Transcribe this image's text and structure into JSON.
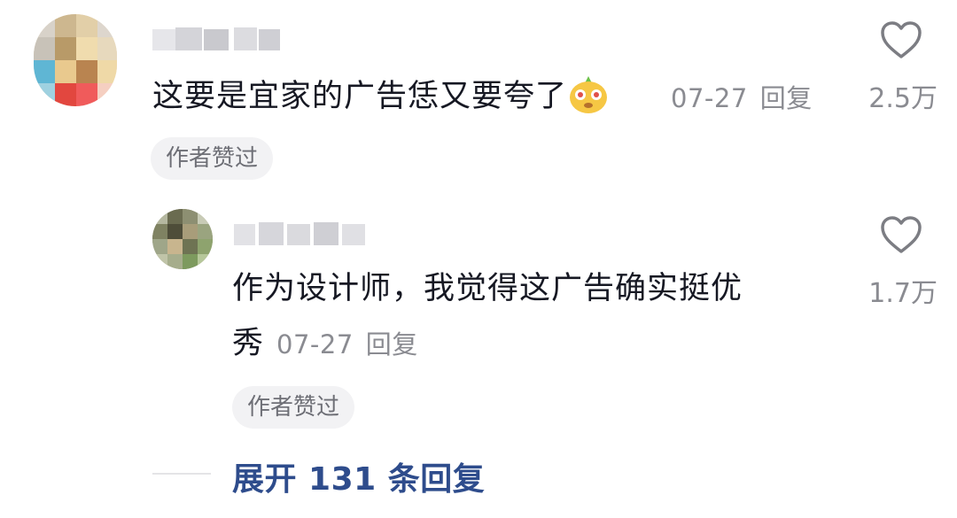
{
  "comment": {
    "text": "这要是宜家的广告恁又要夸了",
    "emoji_icon": "cute-face-emoji-icon",
    "date": "07-27",
    "reply_label": "回复",
    "likes": "2.5万",
    "author_badge": "作者赞过"
  },
  "reply": {
    "text_line1": "作为设计师，我觉得这广告确实挺优",
    "text_line2": "秀",
    "date": "07-27",
    "reply_label": "回复",
    "likes": "1.7万",
    "author_badge": "作者赞过"
  },
  "expand": {
    "label": "展开 131 条回复"
  },
  "colors": {
    "text": "#161823",
    "meta": "#8a8b91",
    "link": "#2e4c8c",
    "badge_bg": "#f2f2f4"
  }
}
